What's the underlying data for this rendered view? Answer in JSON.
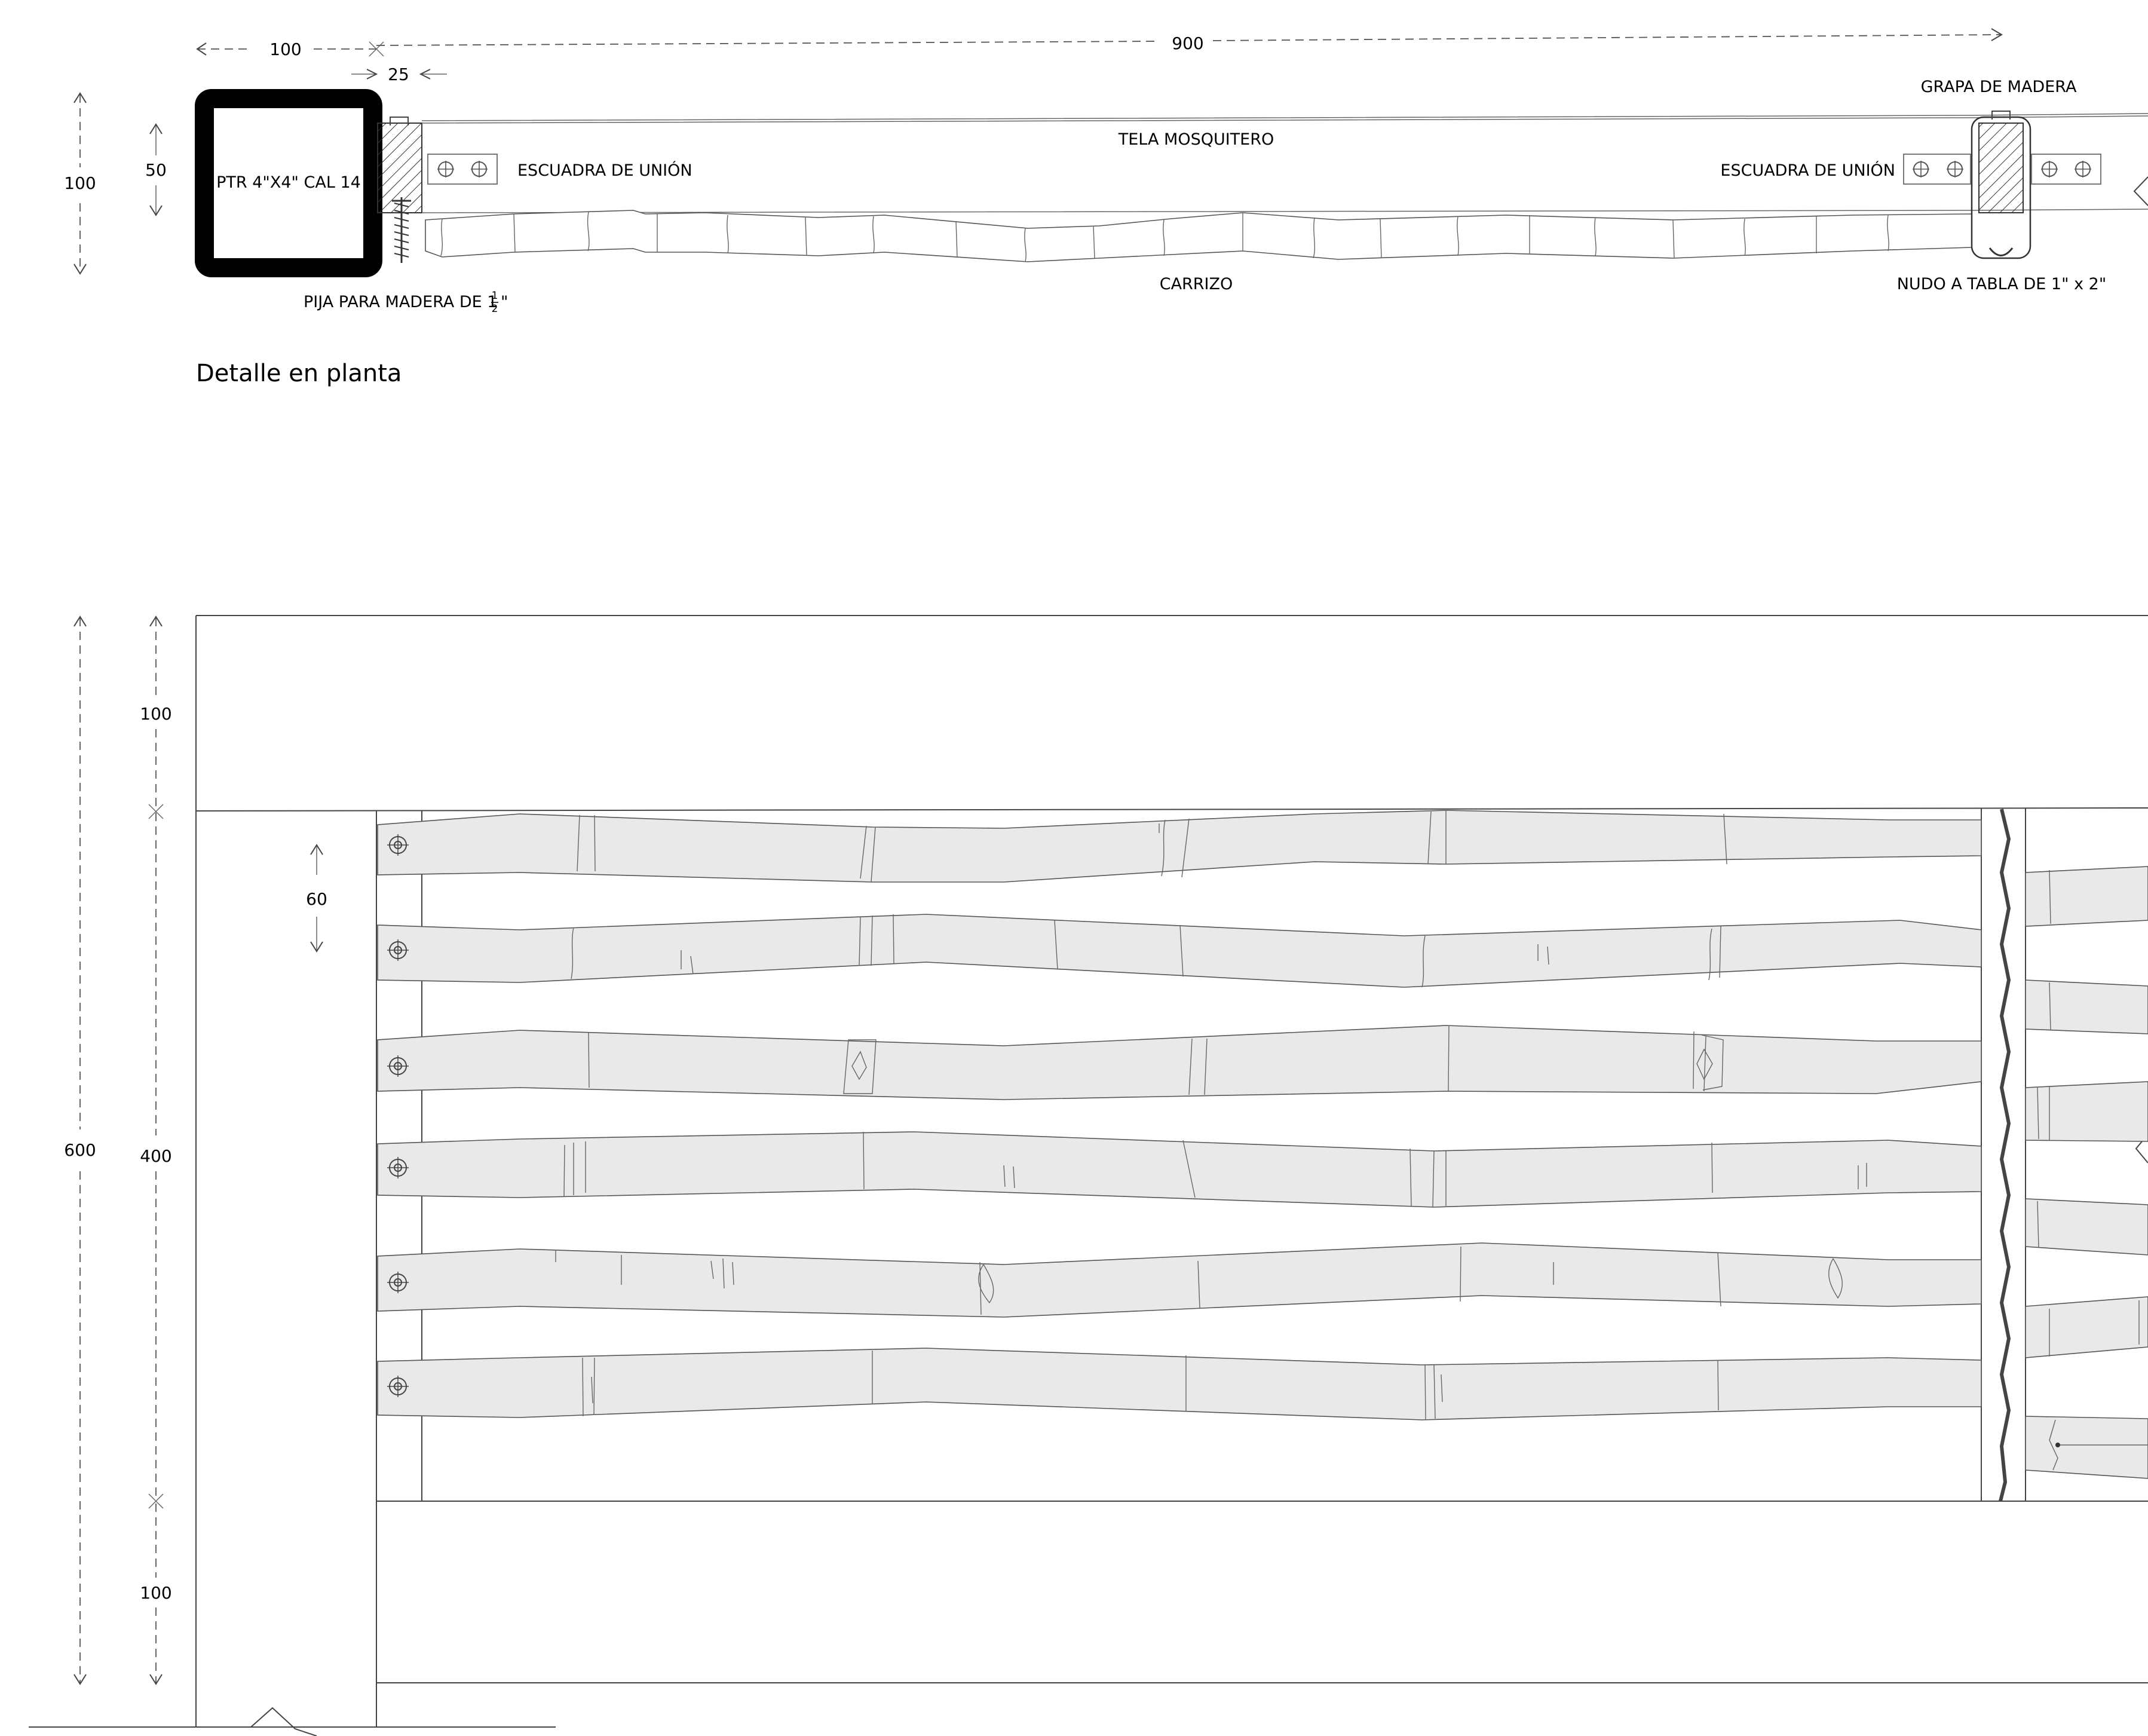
{
  "plan": {
    "title": "Detalle en planta",
    "dims": {
      "post_width": "100",
      "board_width": "25",
      "overall_length": "900",
      "total_depth": "100",
      "post_depth": "50"
    },
    "labels": {
      "ptr": "PTR 4\"X4\" CAL 14",
      "pija": "PIJA PARA MADERA DE 1",
      "pija_frac_num": "1",
      "pija_frac_den": "2",
      "pija_suffix": "\"",
      "escuadra_left": "ESCUADRA DE UNIÓN",
      "escuadra_right": "ESCUADRA DE UNIÓN",
      "tela": "TELA MOSQUITERO",
      "grapa": "GRAPA DE MADERA",
      "carrizo": "CARRIZO",
      "nudo": "NUDO A TABLA DE 1\" x 2\""
    }
  },
  "elevation": {
    "dims": {
      "total": "600",
      "top": "100",
      "middle": "400",
      "bottom": "100",
      "reed_spacing": "60"
    }
  },
  "colors": {
    "reed_fill": "#e9e9e9",
    "steel": "#000000",
    "line": "#444444"
  }
}
